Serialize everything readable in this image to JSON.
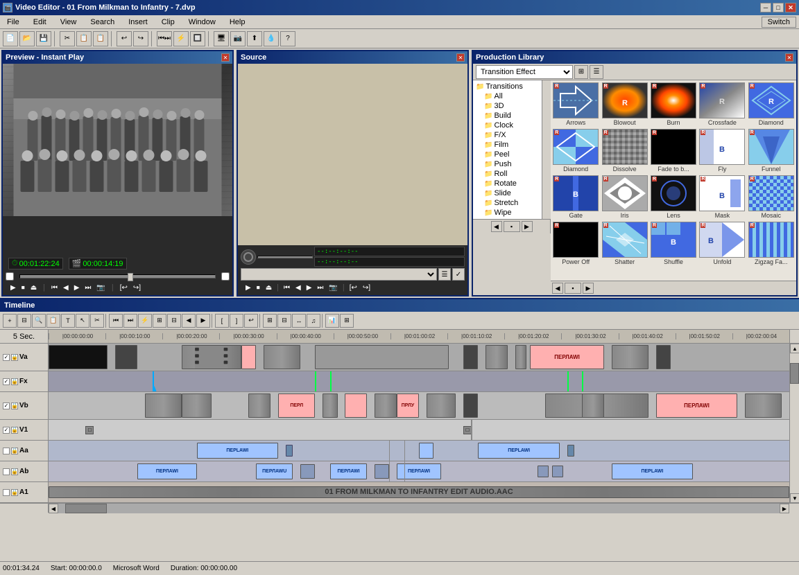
{
  "window": {
    "title": "Video Editor - 01 From Milkman to Infantry - 7.dvp",
    "close_label": "✕",
    "min_label": "─",
    "max_label": "□"
  },
  "menu": {
    "items": [
      "File",
      "Edit",
      "View",
      "Search",
      "Insert",
      "Clip",
      "Window",
      "Help"
    ],
    "switch_label": "Switch"
  },
  "toolbar": {
    "buttons": [
      "📄",
      "📂",
      "💾",
      "✂",
      "📋",
      "📋",
      "↩",
      "↪",
      "⏮",
      "⏭",
      "🔲",
      "🔲",
      "🔲",
      "🖥",
      "📷",
      "⬆",
      "💧",
      "?"
    ]
  },
  "preview": {
    "title": "Preview - Instant Play",
    "time_current": "00:01:22:24",
    "time_duration": "00:00:14:19",
    "transport_buttons": [
      "▶",
      "⏹",
      "⏏",
      "⏮",
      "◀",
      "▶",
      "⏭",
      "📷",
      "[↩",
      "↪]"
    ]
  },
  "source": {
    "title": "Source",
    "transport_time1": "--:--:--:--",
    "transport_time2": "--:--:--:--"
  },
  "production_library": {
    "title": "Production Library",
    "dropdown_label": "Transition Effect",
    "tree_items": [
      {
        "label": "Transitions",
        "level": 0
      },
      {
        "label": "All",
        "level": 1
      },
      {
        "label": "3D",
        "level": 1
      },
      {
        "label": "Build",
        "level": 1
      },
      {
        "label": "Clock",
        "level": 1
      },
      {
        "label": "F/X",
        "level": 1
      },
      {
        "label": "Film",
        "level": 1
      },
      {
        "label": "Peel",
        "level": 1
      },
      {
        "label": "Push",
        "level": 1
      },
      {
        "label": "Roll",
        "level": 1
      },
      {
        "label": "Rotate",
        "level": 1
      },
      {
        "label": "Slide",
        "level": 1
      },
      {
        "label": "Stretch",
        "level": 1
      },
      {
        "label": "Wipe",
        "level": 1
      }
    ],
    "thumbnails": [
      {
        "label": "Arrows",
        "style": "arrows"
      },
      {
        "label": "Blowout",
        "style": "blowout"
      },
      {
        "label": "Burn",
        "style": "burn"
      },
      {
        "label": "Crossfade",
        "style": "crossfade"
      },
      {
        "label": "Diamond",
        "style": "diamond"
      },
      {
        "label": "Diamond",
        "style": "diamond2"
      },
      {
        "label": "Dissolve",
        "style": "dissolve"
      },
      {
        "label": "Fade to b...",
        "style": "fadetob"
      },
      {
        "label": "Fly",
        "style": "fly"
      },
      {
        "label": "Funnel",
        "style": "funnel"
      },
      {
        "label": "Gate",
        "style": "gate"
      },
      {
        "label": "Iris",
        "style": "iris"
      },
      {
        "label": "Lens",
        "style": "lens"
      },
      {
        "label": "Mask",
        "style": "mask"
      },
      {
        "label": "Mosaic",
        "style": "mosaic"
      },
      {
        "label": "Power Off",
        "style": "poweroff"
      },
      {
        "label": "Shatter",
        "style": "shatter"
      },
      {
        "label": "Shuffle",
        "style": "shuffle"
      },
      {
        "label": "Unfold",
        "style": "unfold"
      },
      {
        "label": "Zigzag Fa...",
        "style": "zigzag"
      }
    ]
  },
  "timeline": {
    "title": "Timeline",
    "ruler_labels": [
      "5 Sec.",
      "|00:00:00:00",
      "|00:00:10:00",
      "|00:00:20:00",
      "|00:00:30:00",
      "|00:00:40:00",
      "|00:00:50:00",
      "|00:01:00:02",
      "|00:01:10:02",
      "|00:01:20:02",
      "|00:01:30:02",
      "|00:01:40:02",
      "|00:01:50:02",
      "|00:02:00:04"
    ],
    "tracks": [
      {
        "name": "Va",
        "type": "video"
      },
      {
        "name": "Fx",
        "type": "fx"
      },
      {
        "name": "Vb",
        "type": "video"
      },
      {
        "name": "V1",
        "type": "video"
      },
      {
        "name": "Aa",
        "type": "audio"
      },
      {
        "name": "Ab",
        "type": "audio"
      },
      {
        "name": "A1",
        "type": "audio"
      }
    ]
  },
  "status_bar": {
    "time": "00:01:34.24",
    "start": "Start: 00:00:00.0",
    "app": "Microsoft Word",
    "duration": "Duration: 00:00:00.00"
  }
}
